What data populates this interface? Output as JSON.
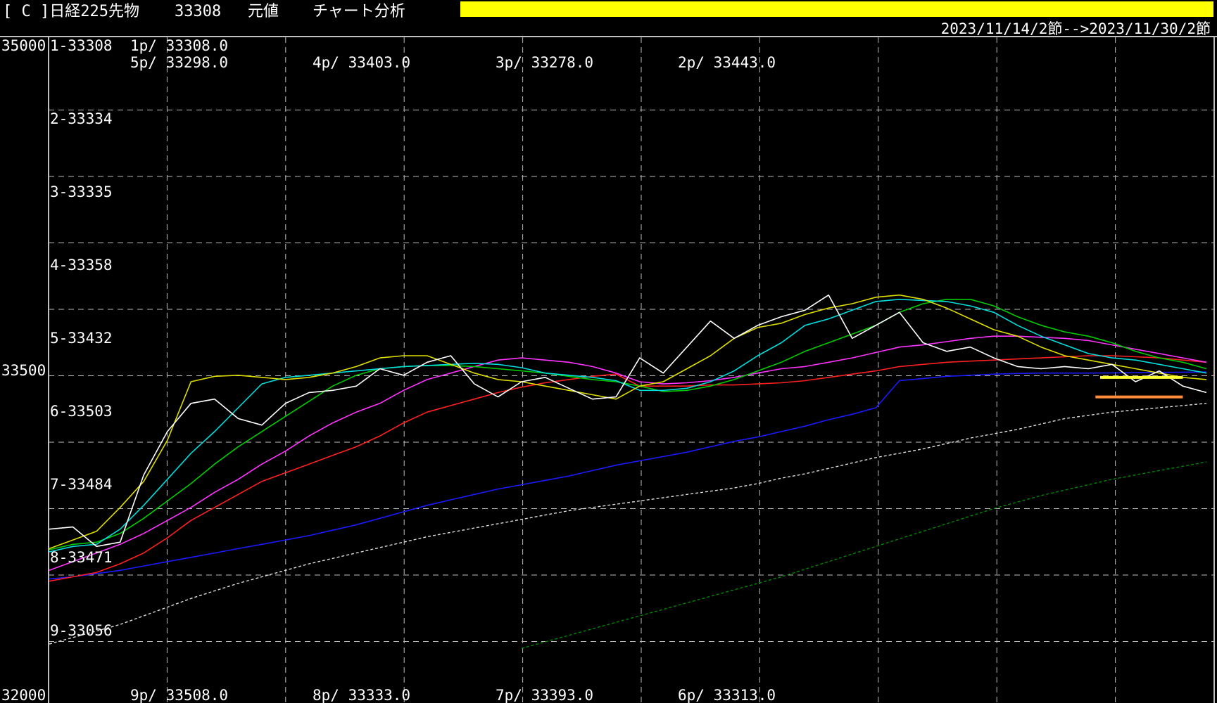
{
  "header": {
    "title": "[ C ]日経225先物",
    "price": "33308",
    "mode": "元値",
    "analysis": "チャート分析",
    "date_range": "2023/11/14/2節-->2023/11/30/2節",
    "banner_color": "#ffff00"
  },
  "chart_data": {
    "type": "line",
    "ylim": [
      32000,
      35000
    ],
    "y_tick_labels": [
      "35000",
      "33500",
      "32000"
    ],
    "x_count": 50,
    "grid": true,
    "levels": [
      "1-33308",
      "2-33334",
      "3-33335",
      "4-33358",
      "5-33432",
      "6-33503",
      "7-33484",
      "8-33471",
      "9-33056"
    ],
    "pivots_top": [
      "1p/ 33308.0",
      "5p/ 33298.0",
      "4p/ 33403.0",
      "3p/ 33278.0",
      "2p/ 33443.0"
    ],
    "pivots_bottom": [
      "9p/ 33508.0",
      "8p/ 33333.0",
      "7p/ 33393.0",
      "6p/ 33313.0"
    ],
    "series": [
      {
        "color": "#008800",
        "dashed": true,
        "x0": 20,
        "values": [
          32210,
          32240,
          32270,
          32300,
          32330,
          32360,
          32390,
          32420,
          32450,
          32480,
          32510,
          32540,
          32575,
          32610,
          32645,
          32680,
          32715,
          32750,
          32785,
          32820,
          32855,
          32885,
          32915,
          32940,
          32965,
          32990,
          33010,
          33030,
          33050,
          33070
        ]
      },
      {
        "color": "#dddddd",
        "dashed": true,
        "x0": 0,
        "values": [
          32230,
          32260,
          32290,
          32320,
          32360,
          32400,
          32440,
          32475,
          32510,
          32540,
          32570,
          32600,
          32625,
          32650,
          32675,
          32700,
          32725,
          32745,
          32765,
          32785,
          32805,
          32825,
          32845,
          32860,
          32875,
          32890,
          32905,
          32920,
          32935,
          32950,
          32970,
          32995,
          33015,
          33040,
          33065,
          33090,
          33110,
          33130,
          33155,
          33180,
          33200,
          33220,
          33245,
          33270,
          33285,
          33300,
          33310,
          33320,
          33330,
          33340
        ]
      },
      {
        "color": "#1a1aff",
        "dashed": false,
        "x0": 0,
        "values": [
          32530,
          32540,
          32555,
          32570,
          32590,
          32610,
          32630,
          32650,
          32670,
          32690,
          32710,
          32730,
          32755,
          32780,
          32810,
          32840,
          32870,
          32895,
          32920,
          32945,
          32965,
          32985,
          33005,
          33030,
          33055,
          33075,
          33095,
          33115,
          33140,
          33165,
          33185,
          33210,
          33235,
          33265,
          33290,
          33320,
          33445,
          33455,
          33465,
          33470,
          33475,
          33478,
          33480,
          33480,
          33480,
          33481,
          33482,
          33483,
          33484,
          33485
        ]
      },
      {
        "color": "#ff2020",
        "dashed": false,
        "x0": 0,
        "values": [
          32520,
          32540,
          32560,
          32600,
          32650,
          32720,
          32800,
          32860,
          32920,
          32980,
          33020,
          33060,
          33100,
          33140,
          33190,
          33250,
          33300,
          33330,
          33360,
          33390,
          33415,
          33435,
          33450,
          33465,
          33475,
          33420,
          33420,
          33420,
          33425,
          33425,
          33430,
          33435,
          33445,
          33460,
          33475,
          33490,
          33510,
          33520,
          33530,
          33535,
          33540,
          33545,
          33550,
          33555,
          33560,
          33560,
          33555,
          33550,
          33540,
          33530
        ]
      },
      {
        "color": "#ff33ff",
        "dashed": false,
        "x0": 0,
        "values": [
          32570,
          32610,
          32650,
          32690,
          32740,
          32800,
          32860,
          32930,
          32990,
          33060,
          33120,
          33190,
          33250,
          33300,
          33340,
          33400,
          33450,
          33480,
          33510,
          33540,
          33550,
          33540,
          33530,
          33510,
          33480,
          33440,
          33430,
          33435,
          33445,
          33460,
          33480,
          33500,
          33510,
          33530,
          33550,
          33575,
          33600,
          33610,
          33625,
          33640,
          33650,
          33650,
          33645,
          33640,
          33630,
          33610,
          33590,
          33570,
          33550,
          33530
        ]
      },
      {
        "color": "#00cc00",
        "dashed": false,
        "x0": 0,
        "values": [
          32665,
          32690,
          32700,
          32740,
          32810,
          32890,
          32970,
          33060,
          33140,
          33210,
          33280,
          33350,
          33420,
          33470,
          33500,
          33510,
          33515,
          33515,
          33510,
          33500,
          33490,
          33480,
          33465,
          33450,
          33440,
          33420,
          33395,
          33400,
          33420,
          33450,
          33490,
          33530,
          33580,
          33620,
          33660,
          33700,
          33760,
          33800,
          33820,
          33820,
          33790,
          33740,
          33700,
          33670,
          33650,
          33620,
          33580,
          33550,
          33530,
          33500
        ]
      },
      {
        "color": "#00dddd",
        "dashed": false,
        "x0": 0,
        "values": [
          32655,
          32680,
          32690,
          32760,
          32870,
          32990,
          33110,
          33210,
          33320,
          33430,
          33460,
          33470,
          33480,
          33490,
          33500,
          33510,
          33515,
          33520,
          33525,
          33520,
          33505,
          33480,
          33470,
          33460,
          33445,
          33400,
          33400,
          33410,
          33440,
          33490,
          33560,
          33620,
          33700,
          33730,
          33770,
          33810,
          33820,
          33815,
          33810,
          33790,
          33760,
          33700,
          33650,
          33610,
          33570,
          33550,
          33540,
          33520,
          33500,
          33480
        ]
      },
      {
        "color": "#dddd00",
        "dashed": false,
        "x0": 0,
        "values": [
          32670,
          32710,
          32750,
          32860,
          32980,
          33170,
          33440,
          33465,
          33470,
          33460,
          33450,
          33460,
          33480,
          33510,
          33550,
          33560,
          33560,
          33520,
          33480,
          33450,
          33440,
          33420,
          33400,
          33380,
          33360,
          33420,
          33440,
          33500,
          33560,
          33640,
          33690,
          33710,
          33750,
          33780,
          33800,
          33830,
          33840,
          33820,
          33780,
          33730,
          33680,
          33650,
          33600,
          33560,
          33540,
          33520,
          33500,
          33480,
          33460,
          33450
        ]
      },
      {
        "color": "#ffffff",
        "dashed": false,
        "x0": 0,
        "values": [
          32760,
          32770,
          32680,
          32700,
          33010,
          33210,
          33340,
          33360,
          33270,
          33240,
          33340,
          33390,
          33400,
          33420,
          33500,
          33470,
          33530,
          33560,
          33430,
          33370,
          33440,
          33460,
          33410,
          33360,
          33370,
          33550,
          33480,
          33600,
          33720,
          33640,
          33700,
          33740,
          33770,
          33840,
          33640,
          33700,
          33760,
          33620,
          33580,
          33600,
          33550,
          33510,
          33500,
          33510,
          33500,
          33520,
          33440,
          33490,
          33420,
          33390
        ]
      }
    ],
    "markers": [
      {
        "color": "#ffff33",
        "from_index": 44.5,
        "to_index": 48,
        "y": 33460
      },
      {
        "color": "#ff8c3c",
        "from_index": 44.3,
        "to_index": 48,
        "y": 33370
      }
    ]
  }
}
